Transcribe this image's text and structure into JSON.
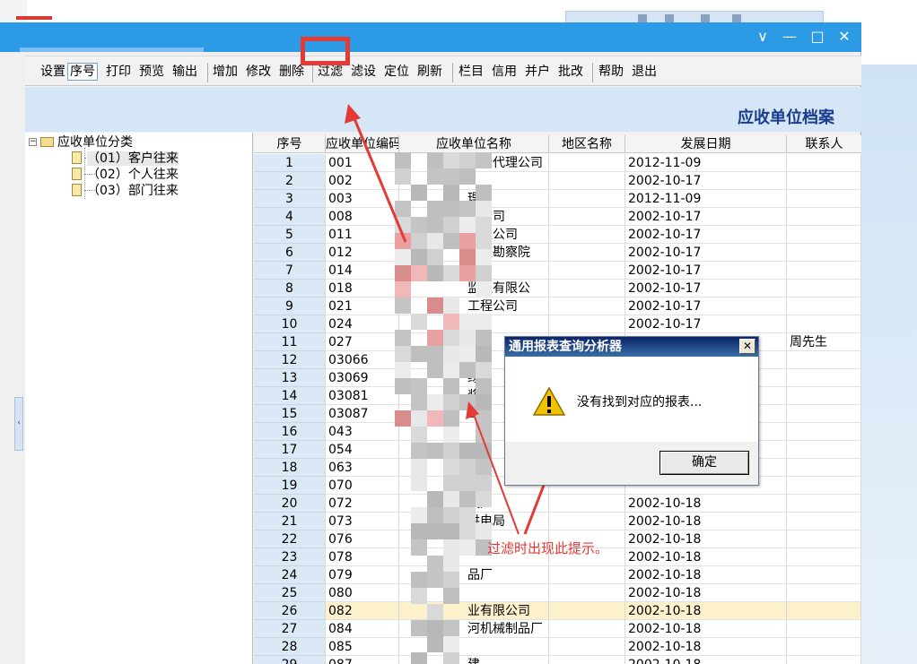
{
  "window": {
    "controls": {
      "dropdown": "∨",
      "minimize": "—",
      "maximize": "□",
      "close": "✕"
    }
  },
  "toolbar": {
    "buttons": [
      "设置",
      "序号",
      "打印",
      "预览",
      "输出",
      "增加",
      "修改",
      "删除",
      "过滤",
      "滤设",
      "定位",
      "刷新",
      "栏目",
      "信用",
      "并户",
      "批改",
      "帮助",
      "退出"
    ]
  },
  "header": {
    "title": "应收单位档案"
  },
  "tree": {
    "root": "应收单位分类",
    "root_toggle": "−",
    "children": [
      "（01）客户往来",
      "（02）个人往来",
      "（03）部门往来"
    ]
  },
  "grid": {
    "columns": [
      "序号",
      "应收单位编码",
      "应收单位名称",
      "地区名称",
      "发展日期",
      "联系人"
    ],
    "rows": [
      {
        "seq": "1",
        "code": "001",
        "name": "招标代理公司",
        "date": "2012-11-09",
        "contact": ""
      },
      {
        "seq": "2",
        "code": "002",
        "name": "",
        "date": "2002-10-17",
        "contact": ""
      },
      {
        "seq": "3",
        "code": "003",
        "name": "理",
        "date": "2012-11-09",
        "contact": ""
      },
      {
        "seq": "4",
        "code": "008",
        "name": "程公司",
        "date": "2002-10-17",
        "contact": ""
      },
      {
        "seq": "5",
        "code": "011",
        "name": "有限公司",
        "date": "2002-10-17",
        "contact": ""
      },
      {
        "seq": "6",
        "code": "012",
        "name": "工程勘察院",
        "date": "2002-10-17",
        "contact": ""
      },
      {
        "seq": "7",
        "code": "014",
        "name": "院",
        "date": "2002-10-17",
        "contact": ""
      },
      {
        "seq": "8",
        "code": "018",
        "name": "监理有限公",
        "date": "2002-10-17",
        "contact": ""
      },
      {
        "seq": "9",
        "code": "021",
        "name": "工程公司",
        "date": "2002-10-17",
        "contact": ""
      },
      {
        "seq": "10",
        "code": "024",
        "name": "宫",
        "date": "2002-10-17",
        "contact": ""
      },
      {
        "seq": "11",
        "code": "027",
        "name": "建商",
        "date": "",
        "contact": "周先生"
      },
      {
        "seq": "12",
        "code": "03066",
        "name": "购",
        "date": "",
        "contact": ""
      },
      {
        "seq": "13",
        "code": "03069",
        "name": "绿",
        "date": "",
        "contact": ""
      },
      {
        "seq": "14",
        "code": "03081",
        "name": "奖",
        "date": "",
        "contact": ""
      },
      {
        "seq": "15",
        "code": "03087",
        "name": "公",
        "date": "",
        "contact": ""
      },
      {
        "seq": "16",
        "code": "043",
        "name": "",
        "date": "",
        "contact": ""
      },
      {
        "seq": "17",
        "code": "054",
        "name": "",
        "date": "",
        "contact": ""
      },
      {
        "seq": "18",
        "code": "063",
        "name": "队备",
        "date": "",
        "contact": ""
      },
      {
        "seq": "19",
        "code": "070",
        "name": "司",
        "date": "",
        "contact": ""
      },
      {
        "seq": "20",
        "code": "072",
        "name": "具厂",
        "date": "2002-10-18",
        "contact": ""
      },
      {
        "seq": "21",
        "code": "073",
        "name": "供电局",
        "date": "2002-10-18",
        "contact": ""
      },
      {
        "seq": "22",
        "code": "076",
        "name": "",
        "date": "2002-10-18",
        "contact": ""
      },
      {
        "seq": "23",
        "code": "078",
        "name": "",
        "date": "2002-10-18",
        "contact": ""
      },
      {
        "seq": "24",
        "code": "079",
        "name": "品厂",
        "date": "2002-10-18",
        "contact": ""
      },
      {
        "seq": "25",
        "code": "080",
        "name": "",
        "date": "2002-10-18",
        "contact": ""
      },
      {
        "seq": "26",
        "code": "082",
        "name": "业有限公司",
        "date": "2002-10-18",
        "contact": ""
      },
      {
        "seq": "27",
        "code": "084",
        "name": "河机械制品厂",
        "date": "2002-10-18",
        "contact": ""
      },
      {
        "seq": "28",
        "code": "085",
        "name": "",
        "date": "2002-10-18",
        "contact": ""
      },
      {
        "seq": "29",
        "code": "087",
        "name": "建",
        "date": "2002-10-18",
        "contact": ""
      }
    ],
    "selected_row": 26
  },
  "dialog": {
    "title": "通用报表查询分析器",
    "close": "✕",
    "message": "没有找到对应的报表...",
    "ok_label": "确定",
    "icon": "warning-icon"
  },
  "annotation": {
    "text": "过滤时出现此提示。",
    "color": "#e53935"
  },
  "colors": {
    "titlebar": "#2d9ae6",
    "header_band": "#d5e7f7",
    "header_title": "#1a3c8a",
    "selected_row": "#fdf1cc",
    "annotation_red": "#e53935"
  }
}
